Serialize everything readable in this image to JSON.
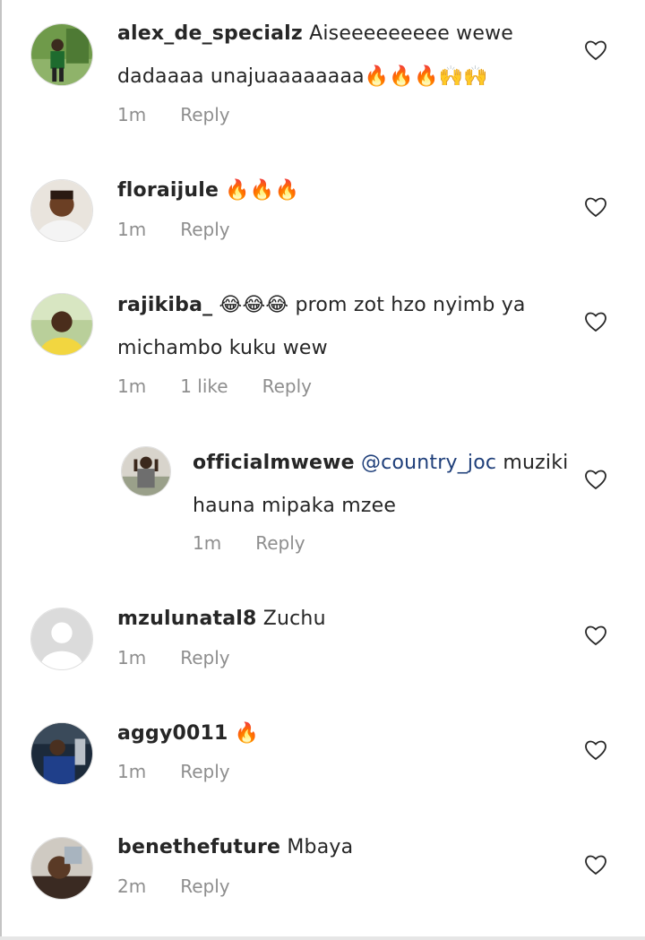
{
  "comments": [
    {
      "username": "alex_de_specialz",
      "text": "Aiseeeeeeeee wewe dadaaaa unajuaaaaaaaa",
      "emoji": "🔥🔥🔥🙌🙌",
      "time": "1m",
      "reply": "Reply"
    },
    {
      "username": "floraijule",
      "text": "",
      "emoji": "🔥🔥🔥",
      "time": "1m",
      "reply": "Reply"
    },
    {
      "username": "rajikiba_",
      "emoji": "😂😂😂",
      "text": "prom zot hzo nyimb ya michambo kuku wew",
      "time": "1m",
      "likes": "1 like",
      "reply": "Reply"
    },
    {
      "username": "officialmwewe",
      "mention": "@country_joc",
      "text": "muziki hauna mipaka mzee",
      "time": "1m",
      "reply": "Reply"
    },
    {
      "username": "mzulunatal8",
      "text": "Zuchu",
      "time": "1m",
      "reply": "Reply"
    },
    {
      "username": "aggy0011",
      "text": "",
      "emoji": "🔥",
      "time": "1m",
      "reply": "Reply"
    },
    {
      "username": "benethefuture",
      "text": "Mbaya",
      "time": "2m",
      "reply": "Reply"
    }
  ],
  "icons": {
    "like": "heart-outline-icon",
    "default_avatar": "default-avatar-icon"
  },
  "colors": {
    "mention": "#1f3f7a",
    "meta_text": "#8e8e8e",
    "username": "#262626"
  }
}
